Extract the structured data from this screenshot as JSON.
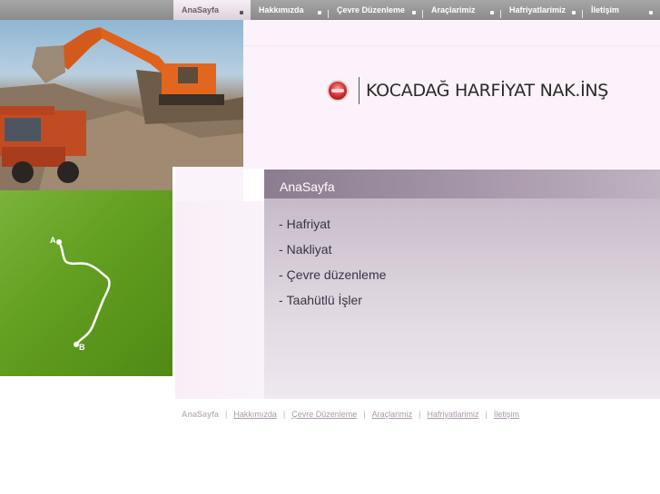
{
  "nav": {
    "items": [
      {
        "label": "AnaSayfa",
        "active": true
      },
      {
        "label": "Hakkımızda",
        "active": false
      },
      {
        "label": "Çevre Düzenleme",
        "active": false
      },
      {
        "label": "Araçlarimiz",
        "active": false
      },
      {
        "label": "Hafriyatlarimiz",
        "active": false
      },
      {
        "label": "İletişim",
        "active": false
      }
    ]
  },
  "brand": {
    "title": "KOCADAĞ HARFİYAT NAK.İNŞ"
  },
  "map": {
    "start_label": "A",
    "end_label": "B"
  },
  "content": {
    "header": "AnaSayfa",
    "menu": [
      {
        "dash": "-",
        "label": "Hafriyat"
      },
      {
        "dash": "-",
        "label": "Nakliyat"
      },
      {
        "dash": "-",
        "label": "Çevre düzenleme"
      },
      {
        "dash": "-",
        "label": "Taahütlü İşler"
      }
    ]
  },
  "footer": {
    "separator": "|",
    "links": [
      {
        "label": "AnaSayfa",
        "active": true
      },
      {
        "label": "Hakkımızda",
        "active": false
      },
      {
        "label": "Çevre Düzenleme",
        "active": false
      },
      {
        "label": "Araçlarimiz",
        "active": false
      },
      {
        "label": "Hafriyatlarimiz",
        "active": false
      },
      {
        "label": "İletişim",
        "active": false
      }
    ]
  },
  "colors": {
    "accent_pink": "#fcf2fb",
    "header_mauve": "#a595a8",
    "green_panel": "#64a022",
    "logo_red": "#d83a3a"
  }
}
